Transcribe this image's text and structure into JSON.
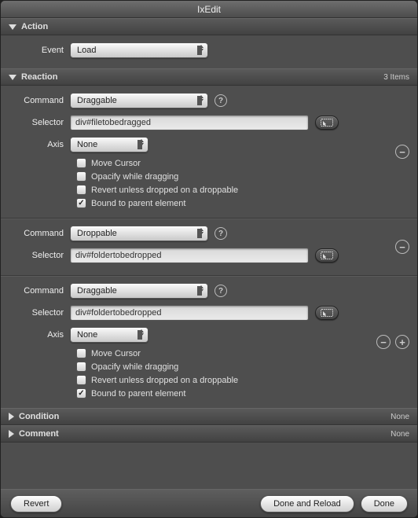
{
  "window": {
    "title": "IxEdit"
  },
  "action": {
    "header": "Action",
    "event_label": "Event",
    "event_value": "Load"
  },
  "reaction": {
    "header": "Reaction",
    "count": "3 Items",
    "items": [
      {
        "command_label": "Command",
        "command_value": "Draggable",
        "selector_label": "Selector",
        "selector_value": "div#filetobedragged",
        "axis_label": "Axis",
        "axis_value": "None",
        "checks": [
          {
            "label": "Move Cursor",
            "checked": false
          },
          {
            "label": "Opacify while dragging",
            "checked": false
          },
          {
            "label": "Revert unless dropped on a droppable",
            "checked": false
          },
          {
            "label": "Bound to parent element",
            "checked": true
          }
        ],
        "has_axis": true,
        "side": [
          "minus"
        ]
      },
      {
        "command_label": "Command",
        "command_value": "Droppable",
        "selector_label": "Selector",
        "selector_value": "div#foldertobedropped",
        "has_axis": false,
        "side": [
          "minus"
        ]
      },
      {
        "command_label": "Command",
        "command_value": "Draggable",
        "selector_label": "Selector",
        "selector_value": "div#foldertobedropped",
        "axis_label": "Axis",
        "axis_value": "None",
        "checks": [
          {
            "label": "Move Cursor",
            "checked": false
          },
          {
            "label": "Opacify while dragging",
            "checked": false
          },
          {
            "label": "Revert unless dropped on a droppable",
            "checked": false
          },
          {
            "label": "Bound to parent element",
            "checked": true
          }
        ],
        "has_axis": true,
        "side": [
          "minus",
          "plus"
        ]
      }
    ]
  },
  "condition": {
    "header": "Condition",
    "value": "None"
  },
  "comment": {
    "header": "Comment",
    "value": "None"
  },
  "footer": {
    "revert": "Revert",
    "done_reload": "Done and Reload",
    "done": "Done"
  }
}
